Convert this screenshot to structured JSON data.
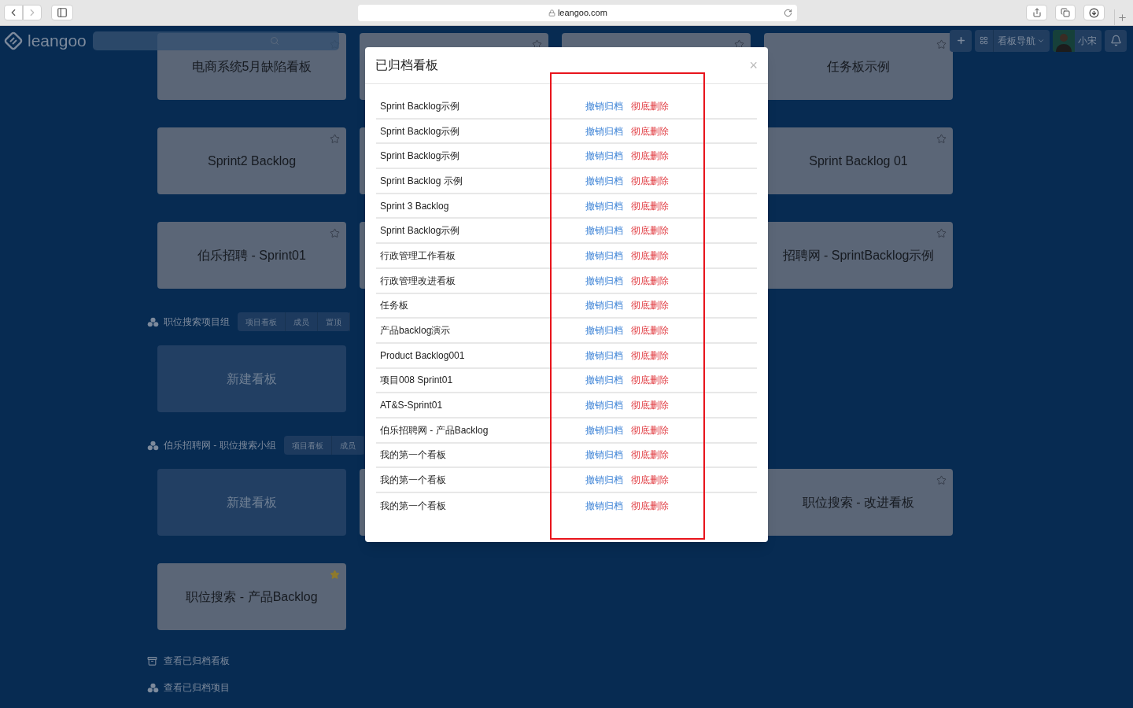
{
  "browser": {
    "url": "leangoo.com"
  },
  "header": {
    "logo": "leangoo",
    "board_nav": "看板导航",
    "user": "小宋"
  },
  "groups": [
    {
      "rows": [
        [
          {
            "kind": "board",
            "title": "电商系统5月缺陷看板",
            "starred": false
          },
          {
            "kind": "board",
            "starred": false
          },
          {
            "kind": "board",
            "starred": false
          },
          {
            "kind": "board",
            "title": "任务板示例",
            "starred": false
          }
        ],
        [
          {
            "kind": "board",
            "title": "Sprint2 Backlog",
            "starred": false
          },
          {
            "kind": "board"
          },
          null,
          {
            "kind": "board",
            "title": "Sprint Backlog 01",
            "starred": false
          }
        ],
        [
          {
            "kind": "board",
            "title": "伯乐招聘 - Sprint01",
            "starred": false
          },
          {
            "kind": "board"
          },
          null,
          {
            "kind": "board",
            "title": "招聘网 - SprintBacklog示例",
            "starred": false
          }
        ]
      ]
    },
    {
      "title": "职位搜索项目组",
      "tabs": [
        "项目看板",
        "成员",
        "置顶"
      ],
      "rows": [
        [
          {
            "kind": "new",
            "title": "新建看板"
          }
        ]
      ]
    },
    {
      "title": "伯乐招聘网 - 职位搜索小组",
      "tabs": [
        "项目看板",
        "成员"
      ],
      "rows": [
        [
          {
            "kind": "new",
            "title": "新建看板"
          },
          {
            "kind": "board"
          },
          null,
          {
            "kind": "board",
            "title": "职位搜索 - 改进看板",
            "starred": false
          }
        ],
        [
          {
            "kind": "board",
            "title": "职位搜索 - 产品Backlog",
            "starred": true
          }
        ]
      ]
    }
  ],
  "footer_links": [
    {
      "kind": "archive",
      "label": "查看已归档看板"
    },
    {
      "kind": "group",
      "label": "查看已归档项目"
    }
  ],
  "modal": {
    "title": "已归档看板",
    "close": "×",
    "rows": [
      {
        "name": "Sprint Backlog示例",
        "restore": "撤销归档",
        "delete": "彻底删除"
      },
      {
        "name": "Sprint Backlog示例",
        "restore": "撤销归档",
        "delete": "彻底删除"
      },
      {
        "name": "Sprint Backlog示例",
        "restore": "撤销归档",
        "delete": "彻底删除"
      },
      {
        "name": "Sprint Backlog 示例",
        "restore": "撤销归档",
        "delete": "彻底删除"
      },
      {
        "name": "Sprint 3 Backlog",
        "restore": "撤销归档",
        "delete": "彻底删除"
      },
      {
        "name": "Sprint Backlog示例",
        "restore": "撤销归档",
        "delete": "彻底删除"
      },
      {
        "name": "行政管理工作看板",
        "restore": "撤销归档",
        "delete": "彻底删除"
      },
      {
        "name": "行政管理改进看板",
        "restore": "撤销归档",
        "delete": "彻底删除"
      },
      {
        "name": "任务板",
        "restore": "撤销归档",
        "delete": "彻底删除"
      },
      {
        "name": "产品backlog演示",
        "restore": "撤销归档",
        "delete": "彻底删除"
      },
      {
        "name": "Product Backlog001",
        "restore": "撤销归档",
        "delete": "彻底删除"
      },
      {
        "name": "项目008 Sprint01",
        "restore": "撤销归档",
        "delete": "彻底删除"
      },
      {
        "name": "AT&S-Sprint01",
        "restore": "撤销归档",
        "delete": "彻底删除"
      },
      {
        "name": "伯乐招聘网 - 产品Backlog",
        "restore": "撤销归档",
        "delete": "彻底删除"
      },
      {
        "name": "我的第一个看板",
        "restore": "撤销归档",
        "delete": "彻底删除"
      },
      {
        "name": "我的第一个看板",
        "restore": "撤销归档",
        "delete": "彻底删除"
      },
      {
        "name": "我的第一个看板",
        "restore": "撤销归档",
        "delete": "彻底删除"
      }
    ],
    "highlight": true
  }
}
